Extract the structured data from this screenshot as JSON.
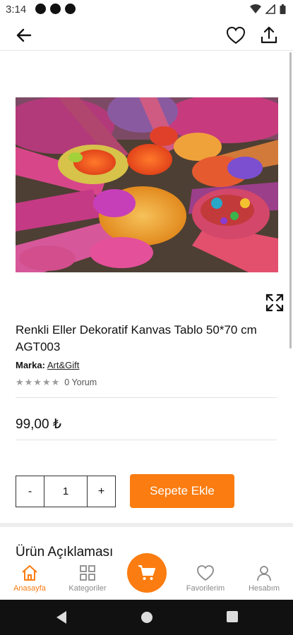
{
  "status_bar": {
    "time": "3:14"
  },
  "product": {
    "title": "Renkli Eller Dekoratif Kanvas Tablo 50*70 cm AGT003",
    "brand_label": "Marka:",
    "brand_name": "Art&Gift",
    "stars": "★★★★★",
    "review_count": "0 Yorum",
    "price": "99,00 ₺"
  },
  "quantity": {
    "decrement": "-",
    "value": "1",
    "increment": "+"
  },
  "cart": {
    "add_label": "Sepete Ekle"
  },
  "description": {
    "title": "Ürün Açıklaması"
  },
  "bottom_nav": {
    "items": [
      {
        "label": "Anasayfa",
        "icon": "home-icon",
        "active": true
      },
      {
        "label": "Kategoriler",
        "icon": "grid-icon",
        "active": false
      },
      {
        "label": "Favorilerim",
        "icon": "heart-icon",
        "active": false
      },
      {
        "label": "Hesabım",
        "icon": "person-icon",
        "active": false
      }
    ],
    "center_icon": "cart-icon"
  },
  "colors": {
    "accent": "#fb7c10",
    "nav_inactive": "#8a8a8a"
  }
}
